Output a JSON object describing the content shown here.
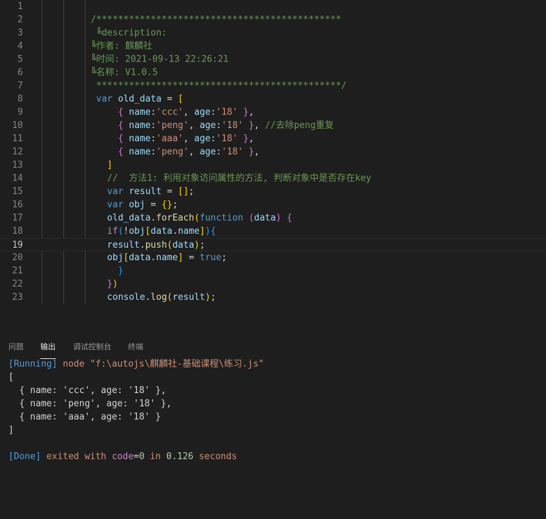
{
  "editor": {
    "current_line": 19,
    "lines": [
      {
        "n": "1",
        "tokens": []
      },
      {
        "n": "2",
        "tokens": [
          {
            "t": "         /*********************************************",
            "c": "cm"
          }
        ]
      },
      {
        "n": "3",
        "tokens": [
          {
            "t": "          ╚description:",
            "c": "cm"
          }
        ]
      },
      {
        "n": "4",
        "tokens": [
          {
            "t": "         ╚作者: 麒麟社",
            "c": "cm"
          }
        ]
      },
      {
        "n": "5",
        "tokens": [
          {
            "t": "         ╚时间: 2021-09-13 22:26:21",
            "c": "cm"
          }
        ]
      },
      {
        "n": "6",
        "tokens": [
          {
            "t": "         ╚名称: V1.0.5",
            "c": "cm"
          }
        ]
      },
      {
        "n": "7",
        "tokens": [
          {
            "t": "          *********************************************/",
            "c": "cm"
          }
        ]
      },
      {
        "n": "8",
        "tokens": [
          {
            "t": "          ",
            "c": "pun"
          },
          {
            "t": "var",
            "c": "kw"
          },
          {
            "t": " ",
            "c": "pun"
          },
          {
            "t": "old_data",
            "c": "var"
          },
          {
            "t": " = ",
            "c": "pun"
          },
          {
            "t": "[",
            "c": "brY"
          }
        ]
      },
      {
        "n": "9",
        "tokens": [
          {
            "t": "              ",
            "c": "pun"
          },
          {
            "t": "{",
            "c": "brP"
          },
          {
            "t": " ",
            "c": "pun"
          },
          {
            "t": "name",
            "c": "var"
          },
          {
            "t": ":",
            "c": "pun"
          },
          {
            "t": "'ccc'",
            "c": "str"
          },
          {
            "t": ", ",
            "c": "pun"
          },
          {
            "t": "age",
            "c": "var"
          },
          {
            "t": ":",
            "c": "pun"
          },
          {
            "t": "'18'",
            "c": "str"
          },
          {
            "t": " ",
            "c": "pun"
          },
          {
            "t": "}",
            "c": "brP"
          },
          {
            "t": ",",
            "c": "pun"
          }
        ]
      },
      {
        "n": "10",
        "tokens": [
          {
            "t": "              ",
            "c": "pun"
          },
          {
            "t": "{",
            "c": "brP"
          },
          {
            "t": " ",
            "c": "pun"
          },
          {
            "t": "name",
            "c": "var"
          },
          {
            "t": ":",
            "c": "pun"
          },
          {
            "t": "'peng'",
            "c": "str"
          },
          {
            "t": ", ",
            "c": "pun"
          },
          {
            "t": "age",
            "c": "var"
          },
          {
            "t": ":",
            "c": "pun"
          },
          {
            "t": "'18'",
            "c": "str"
          },
          {
            "t": " ",
            "c": "pun"
          },
          {
            "t": "}",
            "c": "brP"
          },
          {
            "t": ", ",
            "c": "pun"
          },
          {
            "t": "//去除peng重复",
            "c": "cm"
          }
        ]
      },
      {
        "n": "11",
        "tokens": [
          {
            "t": "              ",
            "c": "pun"
          },
          {
            "t": "{",
            "c": "brP"
          },
          {
            "t": " ",
            "c": "pun"
          },
          {
            "t": "name",
            "c": "var"
          },
          {
            "t": ":",
            "c": "pun"
          },
          {
            "t": "'aaa'",
            "c": "str"
          },
          {
            "t": ", ",
            "c": "pun"
          },
          {
            "t": "age",
            "c": "var"
          },
          {
            "t": ":",
            "c": "pun"
          },
          {
            "t": "'18'",
            "c": "str"
          },
          {
            "t": " ",
            "c": "pun"
          },
          {
            "t": "}",
            "c": "brP"
          },
          {
            "t": ",",
            "c": "pun"
          }
        ]
      },
      {
        "n": "12",
        "tokens": [
          {
            "t": "              ",
            "c": "pun"
          },
          {
            "t": "{",
            "c": "brP"
          },
          {
            "t": " ",
            "c": "pun"
          },
          {
            "t": "name",
            "c": "var"
          },
          {
            "t": ":",
            "c": "pun"
          },
          {
            "t": "'peng'",
            "c": "str"
          },
          {
            "t": ", ",
            "c": "pun"
          },
          {
            "t": "age",
            "c": "var"
          },
          {
            "t": ":",
            "c": "pun"
          },
          {
            "t": "'18'",
            "c": "str"
          },
          {
            "t": " ",
            "c": "pun"
          },
          {
            "t": "}",
            "c": "brP"
          },
          {
            "t": ",",
            "c": "pun"
          }
        ]
      },
      {
        "n": "13",
        "tokens": [
          {
            "t": "            ",
            "c": "pun"
          },
          {
            "t": "]",
            "c": "brY"
          }
        ]
      },
      {
        "n": "14",
        "tokens": [
          {
            "t": "            ",
            "c": "pun"
          },
          {
            "t": "//  方法1: 利用对象访问属性的方法, 判断对象中是否存在key",
            "c": "cm"
          }
        ]
      },
      {
        "n": "15",
        "tokens": [
          {
            "t": "            ",
            "c": "pun"
          },
          {
            "t": "var",
            "c": "kw"
          },
          {
            "t": " ",
            "c": "pun"
          },
          {
            "t": "result",
            "c": "var"
          },
          {
            "t": " = ",
            "c": "pun"
          },
          {
            "t": "[]",
            "c": "brY"
          },
          {
            "t": ";",
            "c": "pun"
          }
        ]
      },
      {
        "n": "16",
        "tokens": [
          {
            "t": "            ",
            "c": "pun"
          },
          {
            "t": "var",
            "c": "kw"
          },
          {
            "t": " ",
            "c": "pun"
          },
          {
            "t": "obj",
            "c": "var"
          },
          {
            "t": " = ",
            "c": "pun"
          },
          {
            "t": "{}",
            "c": "brY"
          },
          {
            "t": ";",
            "c": "pun"
          }
        ]
      },
      {
        "n": "17",
        "tokens": [
          {
            "t": "            ",
            "c": "pun"
          },
          {
            "t": "old_data",
            "c": "var"
          },
          {
            "t": ".",
            "c": "pun"
          },
          {
            "t": "forEach",
            "c": "fn"
          },
          {
            "t": "(",
            "c": "brY"
          },
          {
            "t": "function",
            "c": "kw"
          },
          {
            "t": " ",
            "c": "pun"
          },
          {
            "t": "(",
            "c": "brP"
          },
          {
            "t": "data",
            "c": "var"
          },
          {
            "t": ")",
            "c": "brP"
          },
          {
            "t": " ",
            "c": "pun"
          },
          {
            "t": "{",
            "c": "brP"
          }
        ]
      },
      {
        "n": "18",
        "tokens": [
          {
            "t": "            ",
            "c": "pun"
          },
          {
            "t": "if",
            "c": "ctrl"
          },
          {
            "t": "(",
            "c": "brB"
          },
          {
            "t": "!",
            "c": "pun"
          },
          {
            "t": "obj",
            "c": "var"
          },
          {
            "t": "[",
            "c": "brY"
          },
          {
            "t": "data",
            "c": "var"
          },
          {
            "t": ".",
            "c": "pun"
          },
          {
            "t": "name",
            "c": "var"
          },
          {
            "t": "]",
            "c": "brY"
          },
          {
            "t": ")",
            "c": "brB"
          },
          {
            "t": "{",
            "c": "brB"
          }
        ]
      },
      {
        "n": "19",
        "tokens": [
          {
            "t": "            ",
            "c": "pun"
          },
          {
            "t": "result",
            "c": "var"
          },
          {
            "t": ".",
            "c": "pun"
          },
          {
            "t": "push",
            "c": "fn"
          },
          {
            "t": "(",
            "c": "brY"
          },
          {
            "t": "data",
            "c": "var"
          },
          {
            "t": ")",
            "c": "brY"
          },
          {
            "t": ";",
            "c": "pun"
          }
        ]
      },
      {
        "n": "20",
        "tokens": [
          {
            "t": "            ",
            "c": "pun"
          },
          {
            "t": "obj",
            "c": "var"
          },
          {
            "t": "[",
            "c": "brY"
          },
          {
            "t": "data",
            "c": "var"
          },
          {
            "t": ".",
            "c": "pun"
          },
          {
            "t": "name",
            "c": "var"
          },
          {
            "t": "]",
            "c": "brY"
          },
          {
            "t": " = ",
            "c": "pun"
          },
          {
            "t": "true",
            "c": "kw"
          },
          {
            "t": ";",
            "c": "pun"
          }
        ]
      },
      {
        "n": "21",
        "tokens": [
          {
            "t": "              ",
            "c": "pun"
          },
          {
            "t": "}",
            "c": "brB"
          }
        ]
      },
      {
        "n": "22",
        "tokens": [
          {
            "t": "            ",
            "c": "pun"
          },
          {
            "t": "}",
            "c": "brP"
          },
          {
            "t": ")",
            "c": "brY"
          }
        ]
      },
      {
        "n": "23",
        "tokens": [
          {
            "t": "            ",
            "c": "pun"
          },
          {
            "t": "console",
            "c": "var"
          },
          {
            "t": ".",
            "c": "pun"
          },
          {
            "t": "log",
            "c": "fn"
          },
          {
            "t": "(",
            "c": "brY"
          },
          {
            "t": "result",
            "c": "var"
          },
          {
            "t": ")",
            "c": "brY"
          },
          {
            "t": ";",
            "c": "pun"
          }
        ]
      }
    ]
  },
  "panel": {
    "tabs": [
      {
        "label": "问题",
        "active": false
      },
      {
        "label": "输出",
        "active": true
      },
      {
        "label": "调试控制台",
        "active": false
      },
      {
        "label": "终端",
        "active": false
      }
    ],
    "output": [
      [
        {
          "t": "[Running]",
          "c": "o-blue"
        },
        {
          "t": " node ",
          "c": "o-orange"
        },
        {
          "t": "\"f:\\autojs\\麒麟社-基础课程\\练习.js\"",
          "c": "o-orange"
        }
      ],
      [
        {
          "t": "[",
          "c": "pun"
        }
      ],
      [
        {
          "t": "  { name: 'ccc', age: '18' },",
          "c": "pun"
        }
      ],
      [
        {
          "t": "  { name: 'peng', age: '18' },",
          "c": "pun"
        }
      ],
      [
        {
          "t": "  { name: 'aaa', age: '18' }",
          "c": "pun"
        }
      ],
      [
        {
          "t": "]",
          "c": "pun"
        }
      ],
      [],
      [
        {
          "t": "[Done]",
          "c": "o-blue"
        },
        {
          "t": " exited with ",
          "c": "o-orange"
        },
        {
          "t": "code",
          "c": "o-pink"
        },
        {
          "t": "=",
          "c": "pun"
        },
        {
          "t": "0",
          "c": "o-green"
        },
        {
          "t": " in ",
          "c": "o-orange"
        },
        {
          "t": "0.126",
          "c": "o-green"
        },
        {
          "t": " seconds",
          "c": "o-orange"
        }
      ]
    ]
  }
}
